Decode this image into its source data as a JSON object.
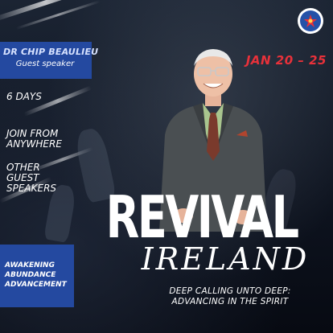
{
  "event": {
    "speaker_name": "DR CHIP BEAULIEU",
    "speaker_role": "Guest speaker",
    "date": "JAN 20 – 25",
    "days": "6 DAYS",
    "join_lines": [
      "JOIN FROM",
      "ANYWHERE"
    ],
    "other_lines": [
      "OTHER",
      "GUEST",
      "SPEAKERS"
    ],
    "title": "REVIVAL",
    "subtitle": "IRELAND",
    "tagline_lines": [
      "DEEP CALLING UNTO DEEP:",
      "ADVANCING IN THE SPIRIT"
    ],
    "themes": [
      "AWAKENING",
      "ABUNDANCE",
      "ADVANCEMENT"
    ]
  },
  "colors": {
    "accent_blue": "#2449a0",
    "date_red": "#e8313a",
    "background": "#0d1320"
  },
  "icons": {
    "logo": "ministry-logo-icon"
  }
}
